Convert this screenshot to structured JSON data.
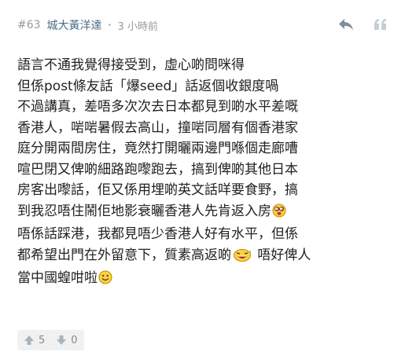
{
  "post": {
    "number": "#63",
    "author": "城大黃洋達",
    "separator": "•",
    "time": "3 小時前"
  },
  "icons": {
    "reply": "reply-arrow-icon",
    "quote": "quote-icon",
    "upvote": "thumb-up-icon",
    "downvote": "thumb-down-icon"
  },
  "content": {
    "lines": [
      "語言不通我覺得接受到，虛心啲問咪得",
      "但係post條友話「爆seed」話返個收銀度喎",
      "不過講真，差唔多次次去日本都見到啲水平差嘅",
      "香港人，啱啱暑假去高山，撞啱同層有個香港家",
      "庭分開兩間房住，竟然打開曬兩邊門喺個走廊嘈",
      "喧巴閉又俾啲細路跑嚟跑去，搞到俾啲其他日本",
      "房客出嚟話，佢又係用埋啲英文話咩要食野，搞",
      "到我忍唔住鬧佢地影衰曬香港人先肯返入房",
      "唔係話踩港，我都見唔少香港人好有水平，但係",
      "都希望出門在外留意下，質素高返啲",
      " 唔好俾人",
      "當中國蝗咁啦"
    ]
  },
  "votes": {
    "up": "5",
    "down": "0"
  },
  "colors": {
    "author": "#4a6e86",
    "meta": "#9a9a9a",
    "text": "#222222",
    "icon": "#9aa8b2"
  }
}
